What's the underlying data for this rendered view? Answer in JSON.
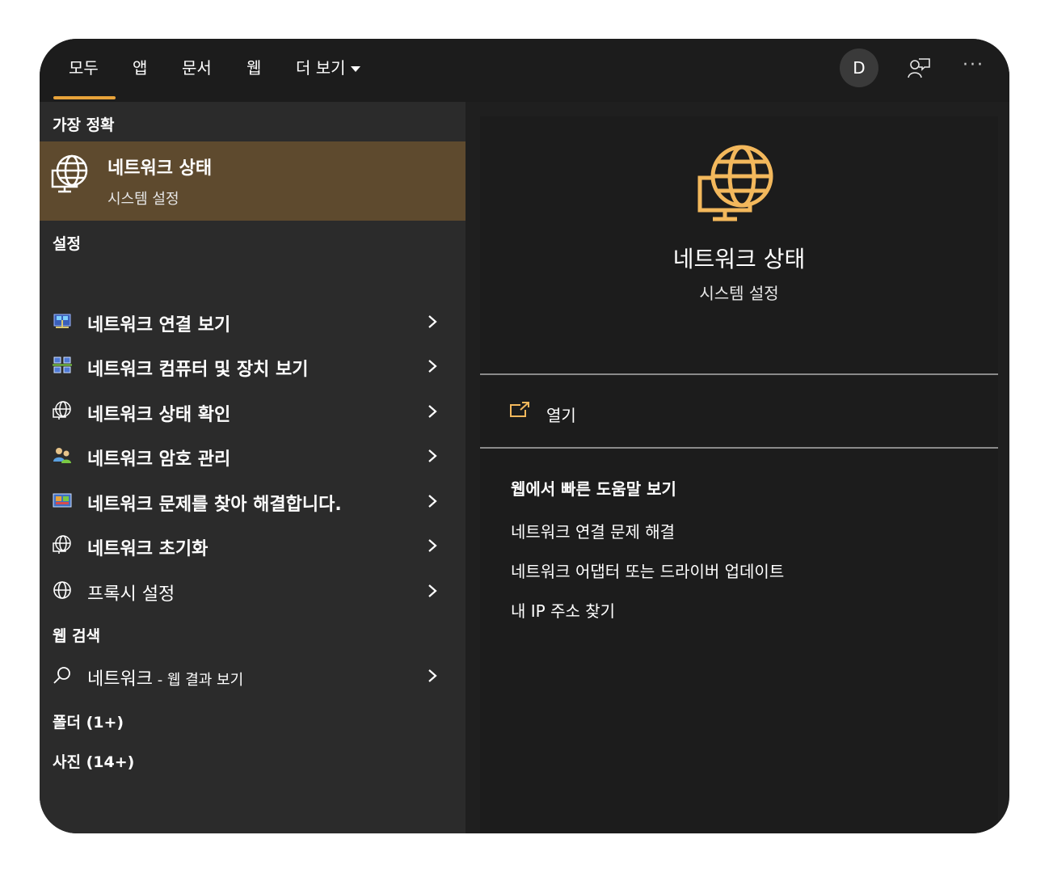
{
  "tabs": [
    {
      "label": "모두"
    },
    {
      "label": "앱"
    },
    {
      "label": "문서"
    },
    {
      "label": "웹"
    },
    {
      "label": "더 보기"
    }
  ],
  "header": {
    "avatar_letter": "D",
    "more_label": "···"
  },
  "best_match": {
    "heading": "가장 정확",
    "title": "네트워크 상태",
    "subtitle": "시스템 설정",
    "icon": "network-globe-monitor-icon"
  },
  "settings": {
    "heading": "설정",
    "items": [
      {
        "label": "네트워크 연결 보기",
        "icon": "network-connections-icon"
      },
      {
        "label": "네트워크 컴퓨터 및 장치 보기",
        "icon": "network-computers-icon"
      },
      {
        "label": "네트워크 상태 확인",
        "icon": "network-globe-monitor-icon"
      },
      {
        "label": "네트워크 암호 관리",
        "icon": "users-key-icon"
      },
      {
        "label": "네트워크 문제를 찾아 해결합니다.",
        "icon": "troubleshoot-icon"
      },
      {
        "label": "네트워크 초기화",
        "icon": "network-globe-monitor-icon"
      },
      {
        "label": "프록시 설정",
        "icon": "globe-icon"
      }
    ]
  },
  "web_search": {
    "heading": "웹 검색",
    "query": "네트워크",
    "suffix": " - 웹 결과 보기"
  },
  "folders": {
    "heading": "폴더 (1+)"
  },
  "photos": {
    "heading": "사진 (14+)"
  },
  "detail": {
    "title": "네트워크 상태",
    "subtitle": "시스템 설정",
    "open_label": "열기",
    "web_heading": "웹에서 빠른 도움말 보기",
    "links": [
      "네트워크 연결 문제 해결",
      "네트워크 어댑터 또는 드라이버 업데이트",
      "내 IP 주소 찾기"
    ]
  },
  "colors": {
    "accent": "#e8a33a",
    "selected_bg": "#5e4a2e",
    "left_bg": "#2b2b2b",
    "right_bg": "#1c1c1c",
    "icon_accent": "#f3b85c"
  }
}
